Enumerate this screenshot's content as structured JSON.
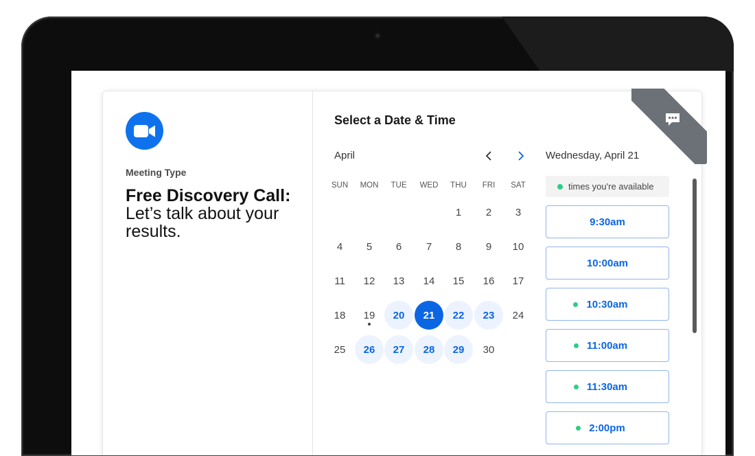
{
  "left": {
    "logo_icon": "zoom-video-camera-icon",
    "meeting_type_label": "Meeting Type",
    "event_title_bold": "Free Discovery Call:",
    "event_title_rest": " Let’s talk about your results."
  },
  "calendar": {
    "heading": "Select a Date & Time",
    "month": "April",
    "weekdays": [
      "SUN",
      "MON",
      "TUE",
      "WED",
      "THU",
      "FRI",
      "SAT"
    ],
    "days": {
      "d1": "1",
      "d2": "2",
      "d3": "3",
      "d4": "4",
      "d5": "5",
      "d6": "6",
      "d7": "7",
      "d8": "8",
      "d9": "9",
      "d10": "10",
      "d11": "11",
      "d12": "12",
      "d13": "13",
      "d14": "14",
      "d15": "15",
      "d16": "16",
      "d17": "17",
      "d18": "18",
      "d19": "19",
      "d20": "20",
      "d21": "21",
      "d22": "22",
      "d23": "23",
      "d24": "24",
      "d25": "25",
      "d26": "26",
      "d27": "27",
      "d28": "28",
      "d29": "29",
      "d30": "30"
    },
    "available_days": [
      "20",
      "21",
      "22",
      "23",
      "26",
      "27",
      "28",
      "29"
    ],
    "selected_day": "21",
    "today_day": "19"
  },
  "times": {
    "date_heading": "Wednesday, April 21",
    "legend_text": "times you're available",
    "slots": [
      "9:30am",
      "10:00am",
      "10:30am",
      "11:00am",
      "11:30am",
      "2:00pm"
    ],
    "slot_available_flags": [
      false,
      false,
      true,
      true,
      true,
      true
    ]
  },
  "colors": {
    "accent": "#0b66e4",
    "available_green": "#2ecc8a",
    "zoom_blue": "#0e72ed",
    "ribbon_gray": "#6b7177"
  },
  "icons": {
    "prev": "chevron-left-icon",
    "next": "chevron-right-icon",
    "ribbon": "chat-bubble-icon"
  }
}
